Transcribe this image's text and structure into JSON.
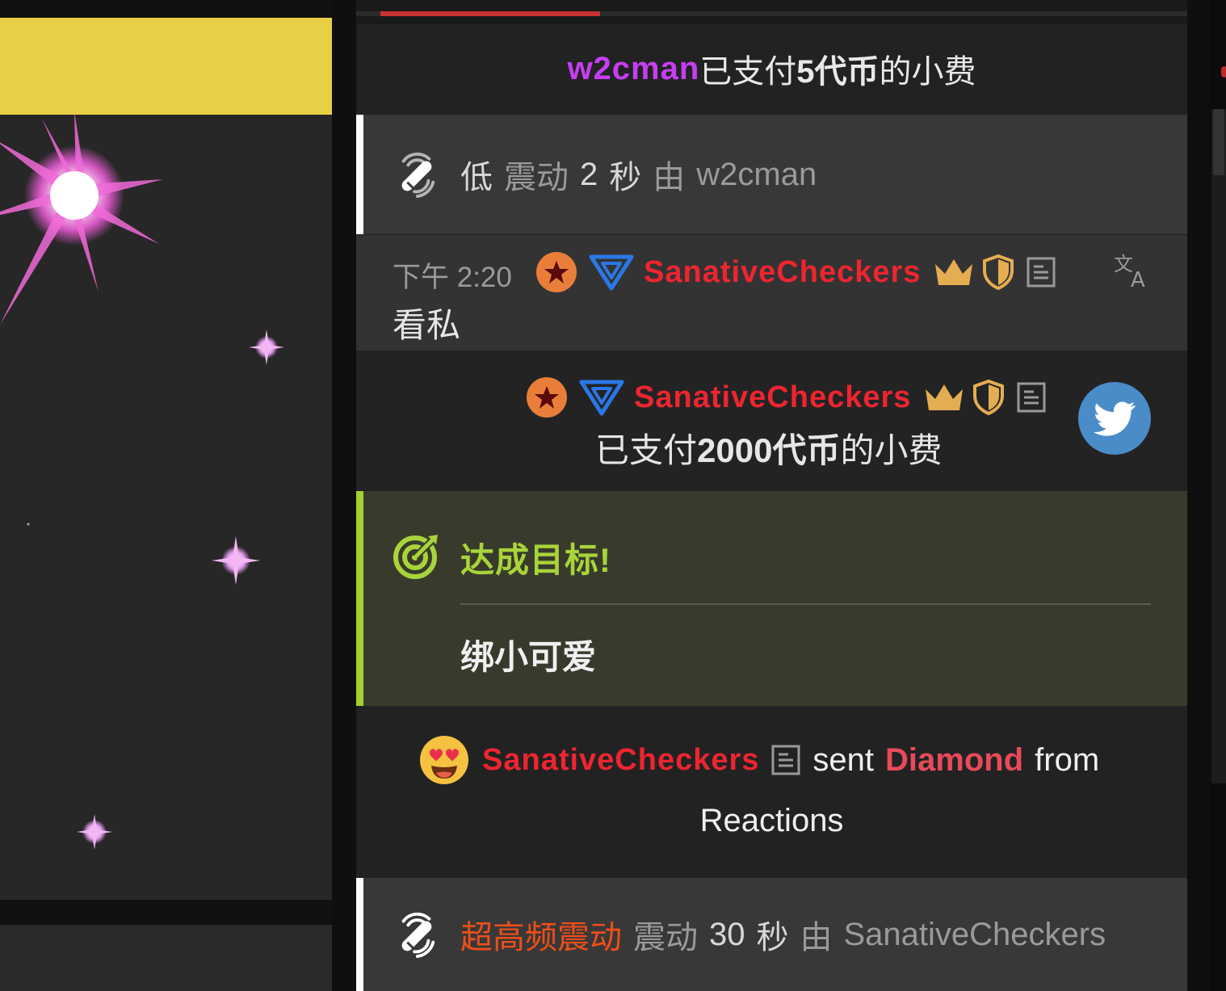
{
  "colors": {
    "tip_username": "#c53ef2",
    "username": "#ed2530",
    "goal_accent": "#a3d12f",
    "vibration_level_hot": "#ee4e19",
    "gift_name": "#e84a5a",
    "progress_fill": "#c53030",
    "preview_bar": "#e9cf45"
  },
  "tip_banner": {
    "username": "w2cman",
    "prefix": "已支付",
    "amount": "5代币",
    "suffix": "的小费"
  },
  "vibration_1": {
    "icon": "vibration-wave-icon",
    "level": "低",
    "action": "震动",
    "duration": "2",
    "unit": "秒",
    "by": "由",
    "user": "w2cman"
  },
  "chat_message": {
    "time": "下午 2:20",
    "badges": [
      "star-badge-icon",
      "triangle-v-badge-icon"
    ],
    "username": "SanativeCheckers",
    "user_icons": [
      "crown-icon",
      "shield-icon",
      "notes-icon"
    ],
    "text": "看私",
    "translate_icon": "translate-icon"
  },
  "tip_2": {
    "username": "SanativeCheckers",
    "prefix": "已支付",
    "amount": "2000代币",
    "suffix": "的小费",
    "avatar_icon": "twitter-bird-icon"
  },
  "goal": {
    "icon": "target-icon",
    "title": "达成目标!",
    "text": "绑小可爱"
  },
  "reaction": {
    "emoji": "heart-eyes-emoji-icon",
    "username": "SanativeCheckers",
    "sent": "sent",
    "gift": "Diamond",
    "from": "from",
    "source": "Reactions"
  },
  "vibration_2": {
    "icon": "vibration-wave-icon",
    "level": "超高频震动",
    "action": "震动",
    "duration": "30",
    "unit": "秒",
    "by": "由",
    "user": "SanativeCheckers"
  }
}
